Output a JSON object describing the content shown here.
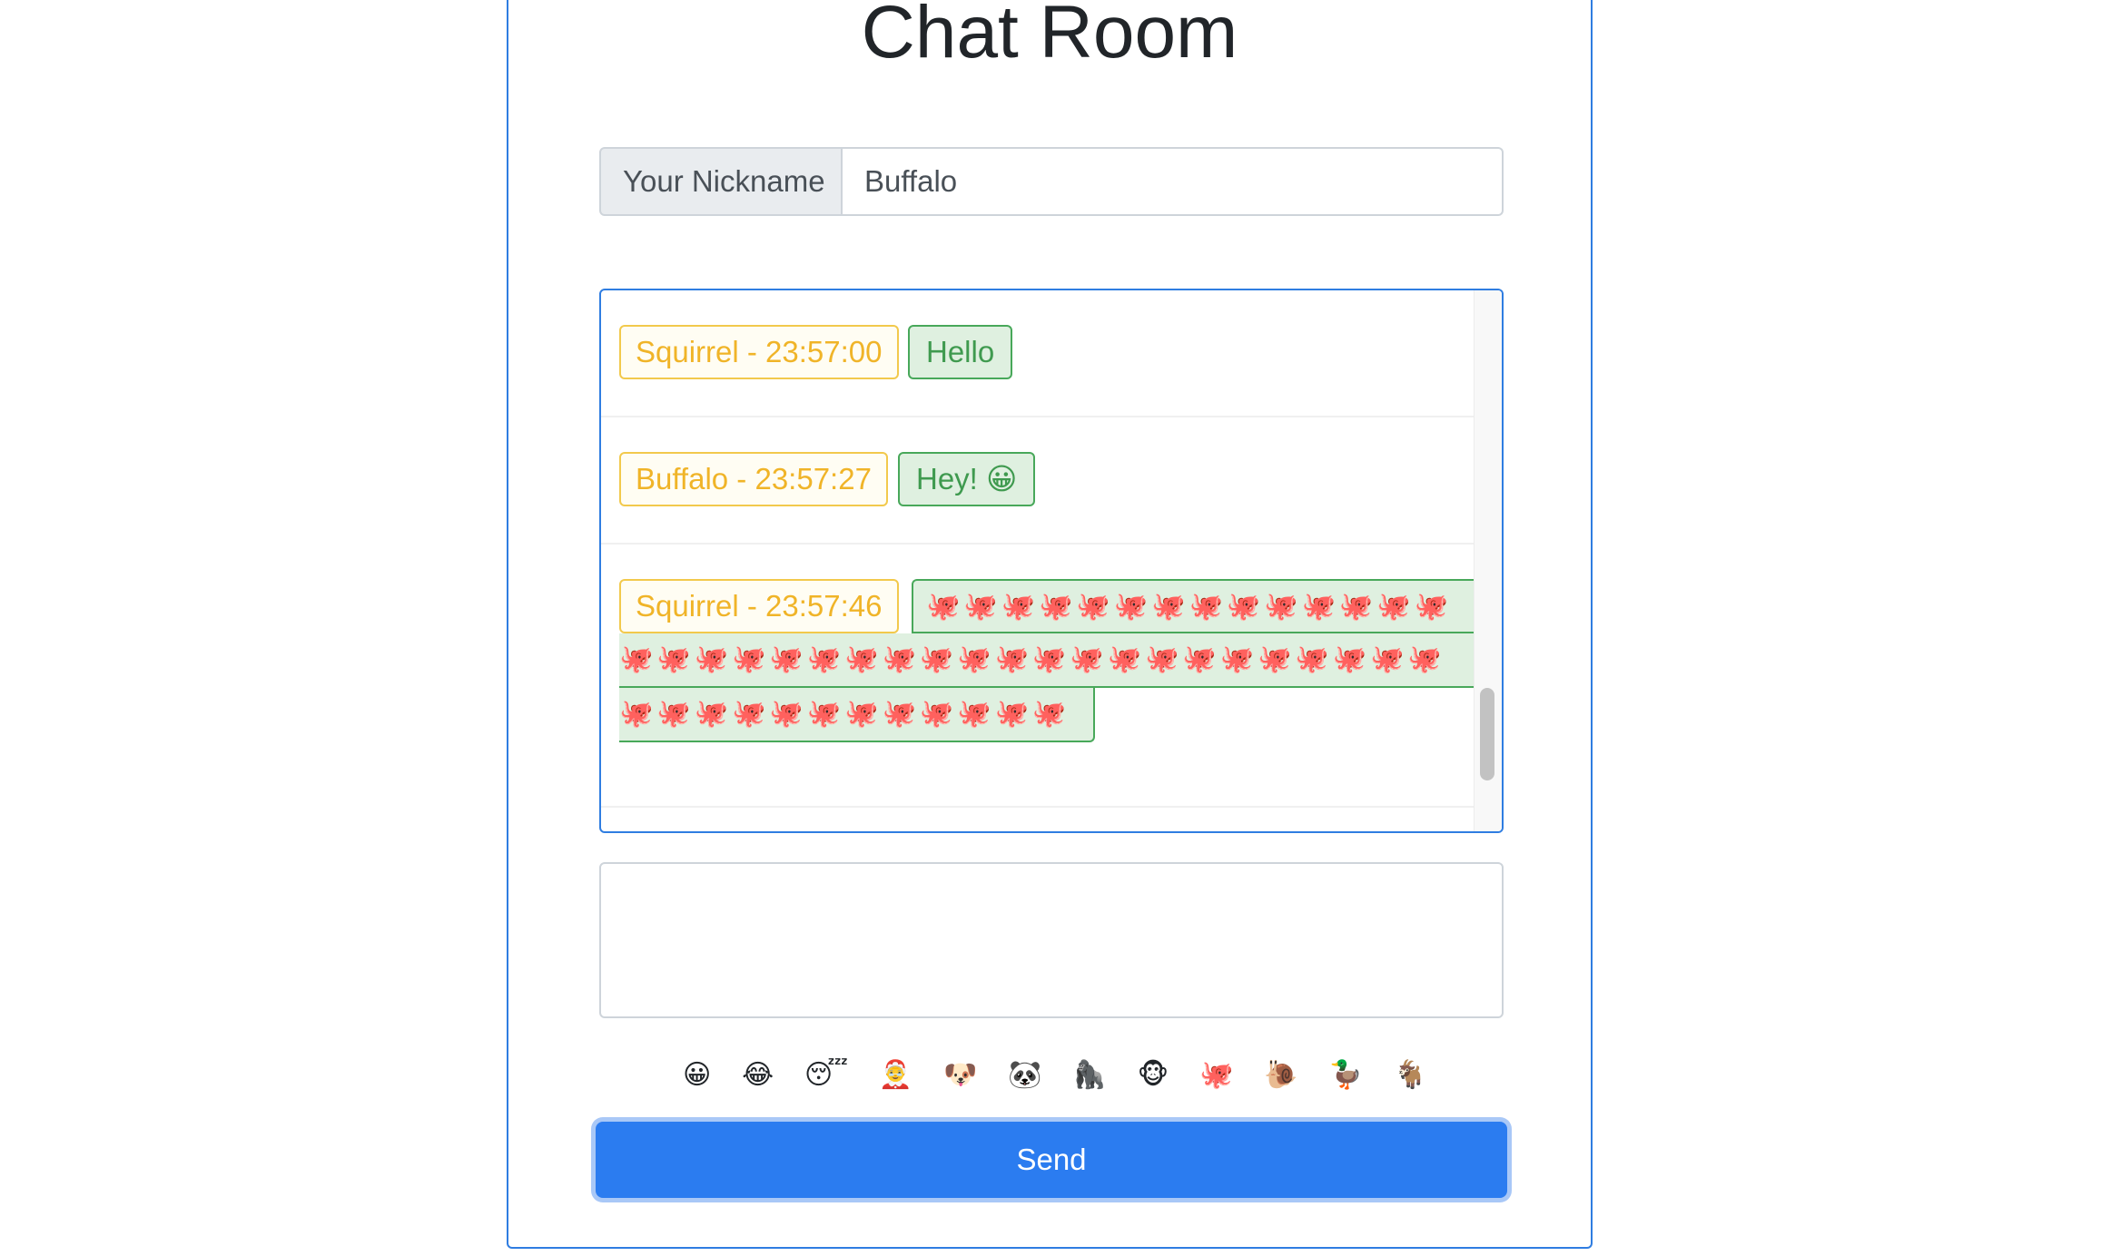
{
  "title": "Chat Room",
  "nickname": {
    "label": "Your Nickname",
    "value": "Buffalo"
  },
  "messages": [
    {
      "meta": "Squirrel - 23:57:00",
      "text": "Hello"
    },
    {
      "meta": "Buffalo - 23:57:27",
      "text": "Hey! 😀"
    },
    {
      "meta": "Squirrel - 23:57:46",
      "lines": [
        "🐙🐙🐙🐙🐙🐙🐙🐙🐙🐙🐙🐙🐙🐙",
        "🐙🐙🐙🐙🐙🐙🐙🐙🐙🐙🐙🐙🐙🐙🐙🐙🐙🐙🐙🐙🐙🐙",
        "🐙🐙🐙🐙🐙🐙🐙🐙🐙🐙🐙🐙"
      ]
    }
  ],
  "composer": {
    "value": ""
  },
  "emoji_picker": [
    "😀",
    "😂",
    "😴",
    "🤶",
    "🐶",
    "🐼",
    "🦍",
    "🐵",
    "🐙",
    "🐌",
    "🦆",
    "🐐"
  ],
  "send_label": "Send",
  "colors": {
    "primary": "#2b7cf0",
    "name_badge": "#f0b428",
    "text_badge": "#3f9a4f"
  }
}
